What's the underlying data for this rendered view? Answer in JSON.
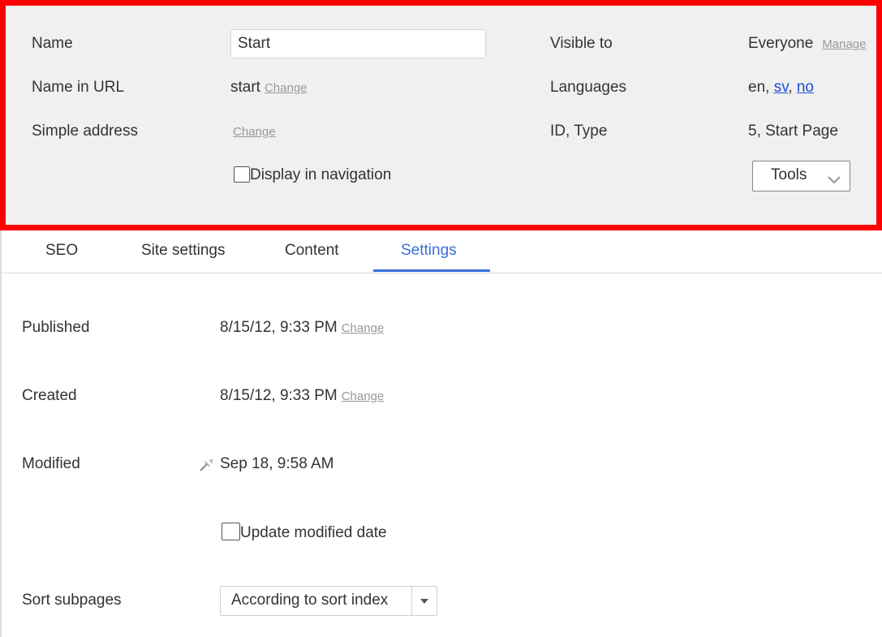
{
  "header": {
    "name_label": "Name",
    "name_value": "Start",
    "name_in_url_label": "Name in URL",
    "name_in_url_value": "start",
    "name_in_url_change": "Change",
    "simple_address_label": "Simple address",
    "simple_address_change": "Change",
    "display_in_navigation_label": "Display in navigation",
    "display_in_navigation_checked": false,
    "visible_to_label": "Visible to",
    "visible_to_value": "Everyone",
    "visible_to_manage": "Manage",
    "languages_label": "Languages",
    "languages_prefix": "en,",
    "languages_sv": "sv",
    "languages_sep": ",",
    "languages_no": "no",
    "id_type_label": "ID, Type",
    "id_type_value": "5, Start Page",
    "tools_label": "Tools"
  },
  "tabs": [
    {
      "label": "SEO"
    },
    {
      "label": "Site settings"
    },
    {
      "label": "Content"
    },
    {
      "label": "Settings",
      "active": true
    }
  ],
  "settings": {
    "published_label": "Published",
    "published_value": "8/15/12, 9:33 PM",
    "published_change": "Change",
    "created_label": "Created",
    "created_value": "8/15/12, 9:33 PM",
    "created_change": "Change",
    "modified_label": "Modified",
    "modified_value": "Sep 18, 9:58 AM",
    "update_modified_label": "Update modified date",
    "update_modified_checked": false,
    "sort_subpages_label": "Sort subpages",
    "sort_subpages_value": "According to sort index"
  },
  "colors": {
    "highlight_border": "#ff0000",
    "accent": "#3b6fd6",
    "link": "#1f4ed8",
    "header_bg": "#f0f0f0"
  }
}
